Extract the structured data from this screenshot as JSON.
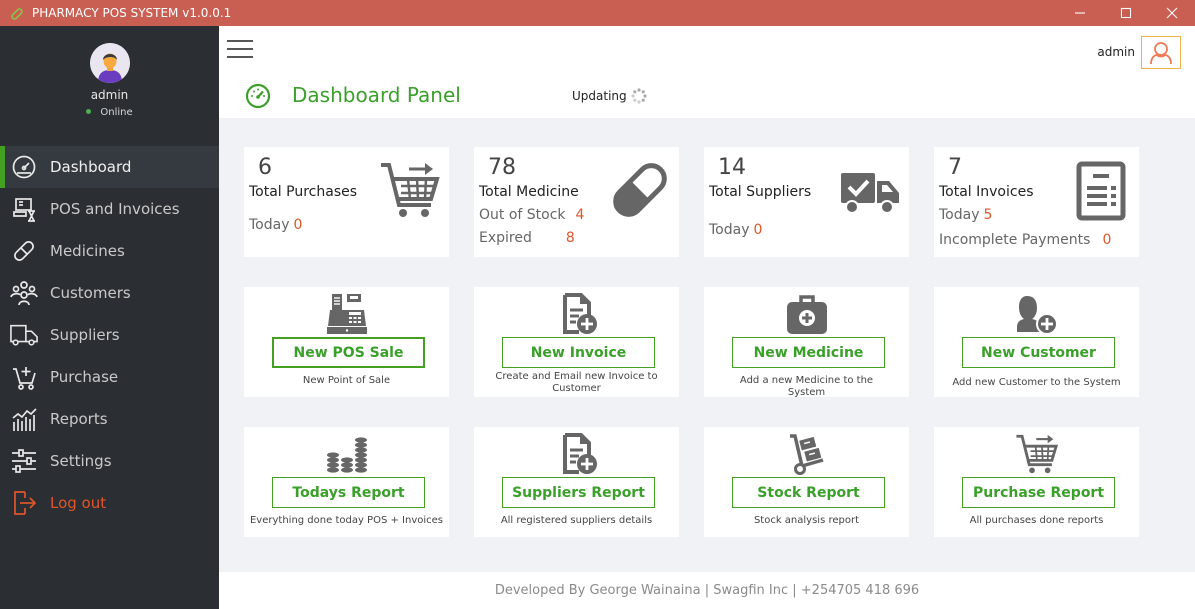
{
  "window": {
    "title": "PHARMACY POS SYSTEM  v1.0.0.1",
    "controls": [
      "minimize",
      "maximize",
      "close"
    ]
  },
  "profile": {
    "name": "admin",
    "status": "Online"
  },
  "sidebar": {
    "items": [
      {
        "label": "Dashboard",
        "icon": "dashboard-gauge-icon",
        "active": true
      },
      {
        "label": "POS and Invoices",
        "icon": "pos-invoice-icon"
      },
      {
        "label": "Medicines",
        "icon": "pill-icon"
      },
      {
        "label": "Customers",
        "icon": "people-icon"
      },
      {
        "label": "Suppliers",
        "icon": "truck-icon"
      },
      {
        "label": "Purchase",
        "icon": "cart-plus-icon"
      },
      {
        "label": "Reports",
        "icon": "chart-bars-icon"
      },
      {
        "label": "Settings",
        "icon": "sliders-icon"
      },
      {
        "label": "Log out",
        "icon": "logout-icon"
      }
    ]
  },
  "header": {
    "user_label": "admin",
    "panel_title": "Dashboard Panel",
    "status_text": "Updating"
  },
  "colors": {
    "accent_green": "#43a020",
    "title_bar": "#c95f53",
    "value_orange": "#e0552a",
    "sidebar_bg": "#2b2f33",
    "user_button_border": "#f0b24a"
  },
  "stats": [
    {
      "value": "6",
      "label": "Total Purchases",
      "lines": [
        {
          "label": "Today",
          "value": "0"
        }
      ],
      "icon": "shopping-cart-icon"
    },
    {
      "value": "78",
      "label": "Total Medicine",
      "lines": [
        {
          "label": "Out of Stock",
          "value": "4"
        },
        {
          "label": "Expired",
          "value": "8"
        }
      ],
      "icon": "capsule-icon"
    },
    {
      "value": "14",
      "label": "Total Suppliers",
      "lines": [
        {
          "label": "Today",
          "value": "0"
        }
      ],
      "icon": "delivery-truck-icon"
    },
    {
      "value": "7",
      "label": "Total Invoices",
      "lines": [
        {
          "label": "Today",
          "value": "5"
        },
        {
          "label": "Incomplete Payments",
          "value": "0"
        }
      ],
      "icon": "invoice-document-icon"
    }
  ],
  "actions": [
    {
      "label": "New POS Sale",
      "desc": "New Point of Sale",
      "icon": "cash-register-icon"
    },
    {
      "label": "New Invoice",
      "desc": "Create and Email new Invoice to Customer",
      "icon": "document-add-icon"
    },
    {
      "label": "New Medicine",
      "desc": "Add a new Medicine to the System",
      "icon": "medical-kit-icon"
    },
    {
      "label": "New Customer",
      "desc": "Add new Customer to the System",
      "icon": "add-user-icon"
    },
    {
      "label": "Todays Report",
      "desc": "Everything done today POS + Invoices",
      "icon": "coin-stacks-icon"
    },
    {
      "label": "Suppliers Report",
      "desc": "All registered suppliers details",
      "icon": "document-add-icon"
    },
    {
      "label": "Stock Report",
      "desc": "Stock analysis report",
      "icon": "hand-truck-icon"
    },
    {
      "label": "Purchase Report",
      "desc": "All purchases done reports",
      "icon": "shopping-cart-icon"
    }
  ],
  "footer": {
    "text": "Developed By George Wainaina | Swagfin Inc | +254705 418 696"
  }
}
